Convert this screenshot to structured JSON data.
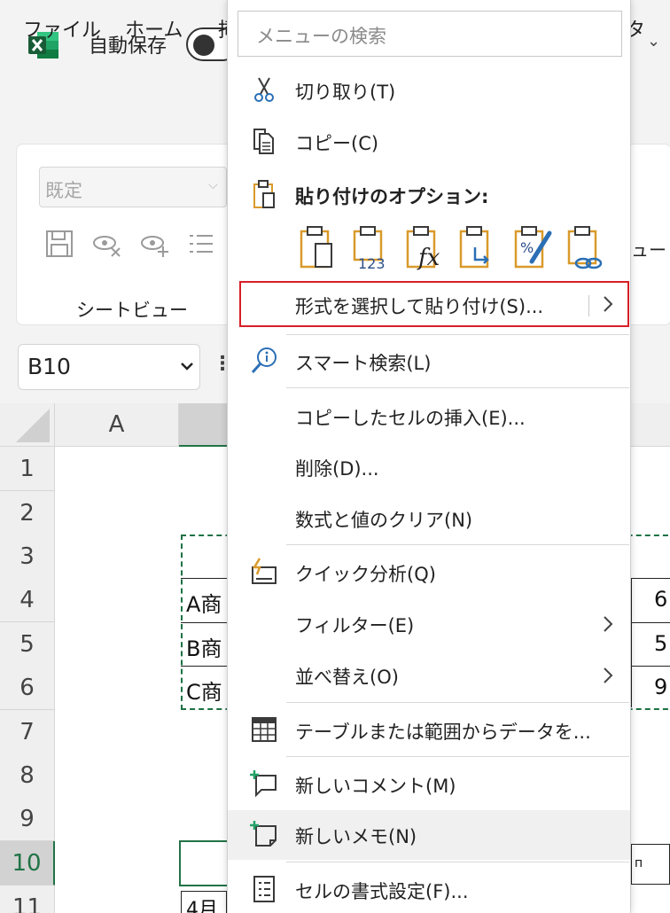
{
  "title_bar": {
    "autosave_label": "自動保存"
  },
  "ribbon_tabs": [
    {
      "label": "ファイル"
    },
    {
      "label": "ホーム"
    },
    {
      "label": "挿"
    },
    {
      "label": "タ"
    }
  ],
  "ribbon": {
    "view_select_value": "既定",
    "group_label": "シートビュー",
    "right_fragment": "ュー"
  },
  "name_box": {
    "value": "B10"
  },
  "grid": {
    "column_headers": [
      "A"
    ],
    "row_headers": [
      "1",
      "2",
      "3",
      "4",
      "5",
      "6",
      "7",
      "8",
      "9",
      "10",
      "11"
    ],
    "active_row": "10",
    "cells": {
      "b4": "A商",
      "b5": "B商",
      "b6": "C商",
      "b11": "4月",
      "right4": "6",
      "right5": "5",
      "right6": "9",
      "right10": "п"
    }
  },
  "context_menu": {
    "search_placeholder": "メニューの検索",
    "items": {
      "cut": "切り取り(T)",
      "copy": "コピー(C)",
      "paste_options_header": "貼り付けのオプション:",
      "paste_special": "形式を選択して貼り付け(S)...",
      "smart_lookup": "スマート検索(L)",
      "insert_copied": "コピーしたセルの挿入(E)...",
      "delete": "削除(D)...",
      "clear_contents": "数式と値のクリア(N)",
      "quick_analysis": "クイック分析(Q)",
      "filter": "フィルター(E)",
      "sort": "並べ替え(O)",
      "table_range": "テーブルまたは範囲からデータを...",
      "new_comment": "新しいコメント(M)",
      "new_note": "新しいメモ(N)",
      "format_cells": "セルの書式設定(F)..."
    },
    "paste_option_icons": [
      "paste-icon",
      "paste-values-icon",
      "paste-formulas-icon",
      "paste-transpose-icon",
      "paste-formatting-icon",
      "paste-link-icon"
    ]
  },
  "colors": {
    "accent_green": "#217346",
    "highlight_red": "#d71f27",
    "icon_orange": "#d99a2b",
    "icon_blue": "#2b6fb5"
  }
}
